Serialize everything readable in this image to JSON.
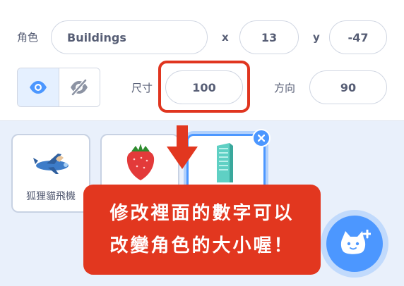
{
  "sprite_info": {
    "sprite_label": "角色",
    "sprite_name": "Buildings",
    "x_label": "x",
    "x_value": "13",
    "y_label": "y",
    "y_value": "-47",
    "size_label": "尺寸",
    "size_value": "100",
    "direction_label": "方向",
    "direction_value": "90",
    "visibility": {
      "show_icon": "eye-icon",
      "hide_icon": "eye-slash-icon",
      "active": "show"
    }
  },
  "sprites": [
    {
      "name": "狐狸貓飛機",
      "icon": "airplane-icon",
      "selected": false
    },
    {
      "name": "",
      "icon": "strawberry-icon",
      "selected": false
    },
    {
      "name": "",
      "icon": "building-icon",
      "selected": true
    }
  ],
  "callout": {
    "line1": "修改裡面的數字可以",
    "line2": "改變角色的大小喔！"
  },
  "colors": {
    "accent": "#4c97ff",
    "highlight": "#e0351f",
    "callout_bg": "#e2371f",
    "pane_bg": "#e9f0fb"
  }
}
